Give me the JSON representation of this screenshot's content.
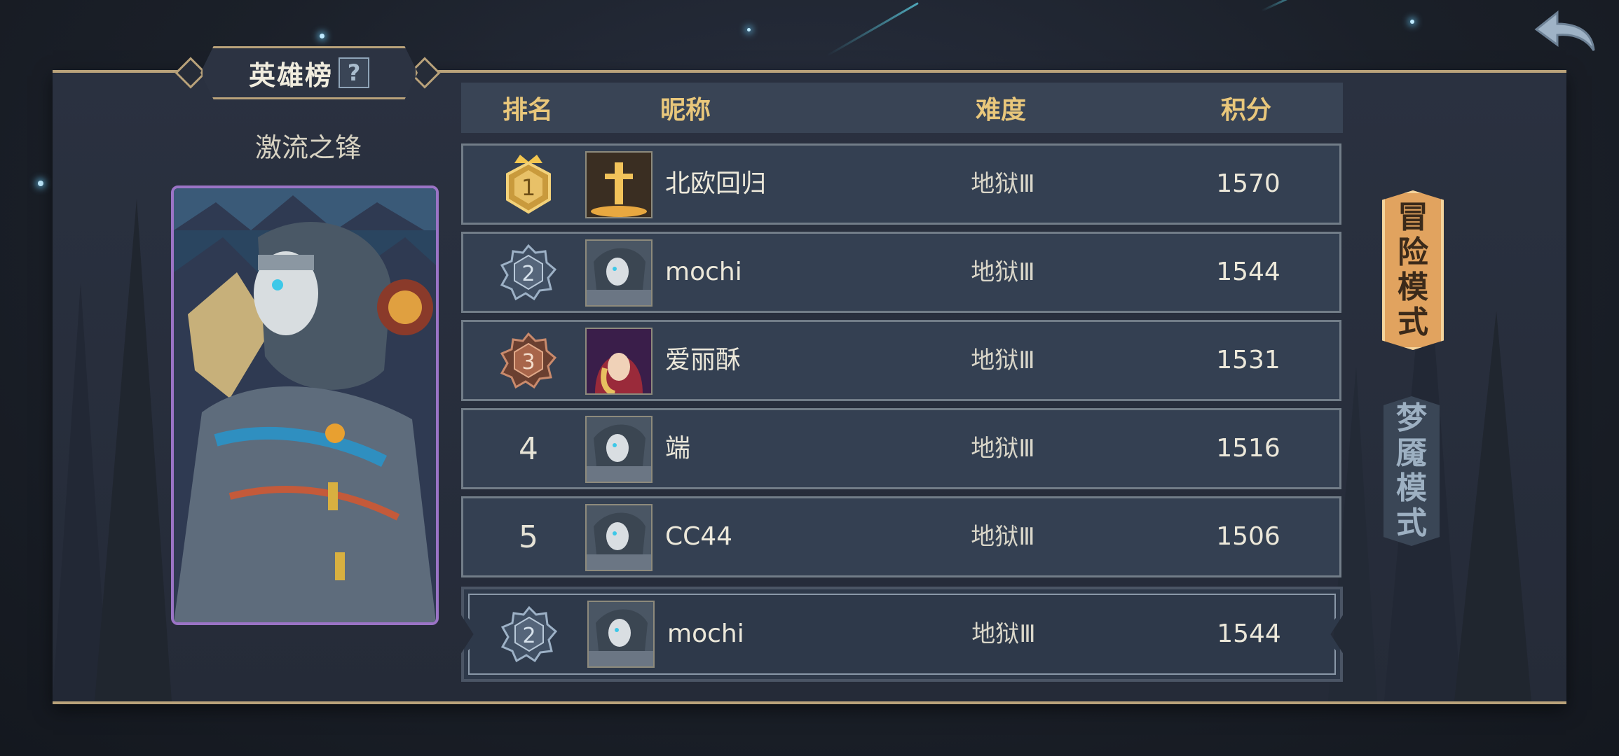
{
  "header": {
    "title": "英雄榜",
    "help_icon": "question-mark-icon"
  },
  "hero": {
    "name": "激流之锋"
  },
  "table": {
    "columns": [
      "排名",
      "昵称",
      "难度",
      "积分"
    ],
    "rows": [
      {
        "rank": "1",
        "rank_style": "gold-crown-badge",
        "name": "北欧回归",
        "avatar": "sword-avatar",
        "difficulty": "地狱Ⅲ",
        "score": "1570"
      },
      {
        "rank": "2",
        "rank_style": "silver-badge",
        "name": "mochi",
        "avatar": "skull-hero-avatar",
        "difficulty": "地狱Ⅲ",
        "score": "1544"
      },
      {
        "rank": "3",
        "rank_style": "bronze-badge",
        "name": "爱丽酥",
        "avatar": "red-hood-avatar",
        "difficulty": "地狱Ⅲ",
        "score": "1531"
      },
      {
        "rank": "4",
        "rank_style": "plain",
        "name": "端",
        "avatar": "skull-hero-avatar",
        "difficulty": "地狱Ⅲ",
        "score": "1516"
      },
      {
        "rank": "5",
        "rank_style": "plain",
        "name": "CC44",
        "avatar": "skull-hero-avatar",
        "difficulty": "地狱Ⅲ",
        "score": "1506"
      }
    ]
  },
  "my_rank": {
    "rank": "2",
    "name": "mochi",
    "difficulty": "地狱Ⅲ",
    "score": "1544"
  },
  "modes": [
    {
      "label_chars": [
        "冒",
        "险",
        "模",
        "式"
      ],
      "active": true
    },
    {
      "label_chars": [
        "梦",
        "魇",
        "模",
        "式"
      ],
      "active": false
    }
  ],
  "colors": {
    "accent_gold": "#e9c77b",
    "active_tab": "#e1a35f",
    "panel": "#2a3140",
    "card_border": "#9b74c6"
  }
}
